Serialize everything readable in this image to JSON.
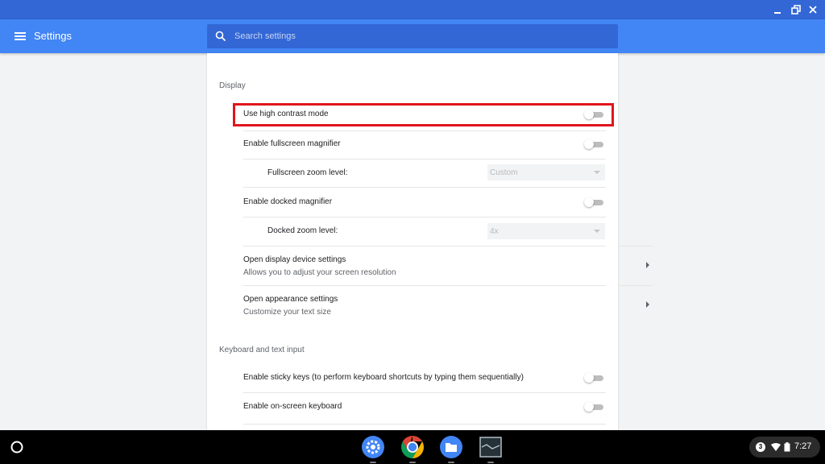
{
  "app": {
    "title": "Settings"
  },
  "search": {
    "placeholder": "Search settings"
  },
  "display": {
    "section_title": "Display",
    "high_contrast": {
      "label": "Use high contrast mode",
      "enabled": false
    },
    "fullscreen_magnifier": {
      "label": "Enable fullscreen magnifier",
      "enabled": false
    },
    "fullscreen_zoom": {
      "label": "Fullscreen zoom level:",
      "value": "Custom"
    },
    "docked_magnifier": {
      "label": "Enable docked magnifier",
      "enabled": false
    },
    "docked_zoom": {
      "label": "Docked zoom level:",
      "value": "4x"
    },
    "device_settings": {
      "label": "Open display device settings",
      "sublabel": "Allows you to adjust your screen resolution"
    },
    "appearance_settings": {
      "label": "Open appearance settings",
      "sublabel": "Customize your text size"
    }
  },
  "keyboard": {
    "section_title": "Keyboard and text input",
    "sticky_keys": {
      "label": "Enable sticky keys (to perform keyboard shortcuts by typing them sequentially)",
      "enabled": false
    },
    "onscreen_keyboard": {
      "label": "Enable on-screen keyboard",
      "enabled": false
    }
  },
  "shelf": {
    "apps": [
      "settings-icon",
      "chrome-icon",
      "files-icon",
      "screenshot-app-icon"
    ],
    "notification_count": "3",
    "clock": "7:27"
  },
  "colors": {
    "header": "#4285f4",
    "title_strip": "#3367d6",
    "highlight_box": "#e1141c",
    "shelf": "#000000"
  }
}
